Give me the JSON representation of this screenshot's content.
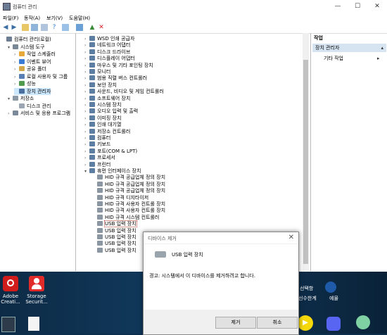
{
  "window": {
    "title": "컴퓨터 관리",
    "controls": [
      "—",
      "☐",
      "✕"
    ]
  },
  "menu": [
    "파일(F)",
    "동작(A)",
    "보기(V)",
    "도움말(H)"
  ],
  "left_tree": [
    {
      "label": "컴퓨터 관리(로컬)",
      "level": 0,
      "arrow": ""
    },
    {
      "label": "시스템 도구",
      "level": 1,
      "arrow": "▾"
    },
    {
      "label": "작업 스케줄러",
      "level": 2,
      "arrow": "›"
    },
    {
      "label": "이벤트 뷰어",
      "level": 2,
      "arrow": "›"
    },
    {
      "label": "공유 폴더",
      "level": 2,
      "arrow": "›"
    },
    {
      "label": "로컬 사용자 및 그룹",
      "level": 2,
      "arrow": "›"
    },
    {
      "label": "성능",
      "level": 2,
      "arrow": "›"
    },
    {
      "label": "장치 관리자",
      "level": 2,
      "arrow": "",
      "selected": true
    },
    {
      "label": "저장소",
      "level": 1,
      "arrow": "▾"
    },
    {
      "label": "디스크 관리",
      "level": 2,
      "arrow": ""
    },
    {
      "label": "서비스 및 응용 프로그램",
      "level": 1,
      "arrow": "›"
    }
  ],
  "device_tree": [
    {
      "label": "WSD 인쇄 공급자",
      "child": false
    },
    {
      "label": "네트워크 어댑터",
      "child": false
    },
    {
      "label": "디스크 드라이브",
      "child": false
    },
    {
      "label": "디스플레이 어댑터",
      "child": false
    },
    {
      "label": "마우스 및 기타 포인팅 장치",
      "child": false
    },
    {
      "label": "모니터",
      "child": false
    },
    {
      "label": "범용 직렬 버스 컨트롤러",
      "child": false
    },
    {
      "label": "보안 장치",
      "child": false
    },
    {
      "label": "사운드, 비디오 및 게임 컨트롤러",
      "child": false
    },
    {
      "label": "소프트웨어 장치",
      "child": false
    },
    {
      "label": "시스템 장치",
      "child": false
    },
    {
      "label": "오디오 입력 및 출력",
      "child": false
    },
    {
      "label": "이미징 장치",
      "child": false
    },
    {
      "label": "인쇄 대기열",
      "child": false
    },
    {
      "label": "저장소 컨트롤러",
      "child": false
    },
    {
      "label": "컴퓨터",
      "child": false
    },
    {
      "label": "키보드",
      "child": false
    },
    {
      "label": "포트(COM & LPT)",
      "child": false
    },
    {
      "label": "프로세서",
      "child": false
    },
    {
      "label": "프린터",
      "child": false
    },
    {
      "label": "휴먼 인터페이스 장치",
      "child": false,
      "expanded": true
    },
    {
      "label": "HID 규격 공급업체 정의 장치",
      "child": true
    },
    {
      "label": "HID 규격 공급업체 정의 장치",
      "child": true
    },
    {
      "label": "HID 규격 공급업체 정의 장치",
      "child": true
    },
    {
      "label": "HID 규격 디지타이저",
      "child": true
    },
    {
      "label": "HID 규격 사용자 컨트롤 장치",
      "child": true
    },
    {
      "label": "HID 규격 사용자 컨트롤 장치",
      "child": true
    },
    {
      "label": "HID 규격 시스템 컨트롤러",
      "child": true
    },
    {
      "label": "USB 입력 장치",
      "child": true,
      "focused": true
    },
    {
      "label": "USB 입력 장치",
      "child": true
    },
    {
      "label": "USB 입력 장치",
      "child": true
    },
    {
      "label": "USB 입력 장치",
      "child": true
    },
    {
      "label": "USB 입력 장치",
      "child": true
    }
  ],
  "actions": {
    "header": "작업",
    "selected": "장치 관리자",
    "item": "기타 작업"
  },
  "dialog": {
    "title": "디바이스 제거",
    "device": "USB 입력 장치",
    "warning": "경고: 시스템에서 이 디바이스를 제거하려고 합니다.",
    "ok": "제거",
    "cancel": "취소"
  },
  "desktop": {
    "icons": [
      {
        "label": "Adobe\nCreati..."
      },
      {
        "label": "Storage\nSecurit..."
      }
    ],
    "tray": [
      "선택항",
      "선수한계",
      "예물"
    ]
  }
}
